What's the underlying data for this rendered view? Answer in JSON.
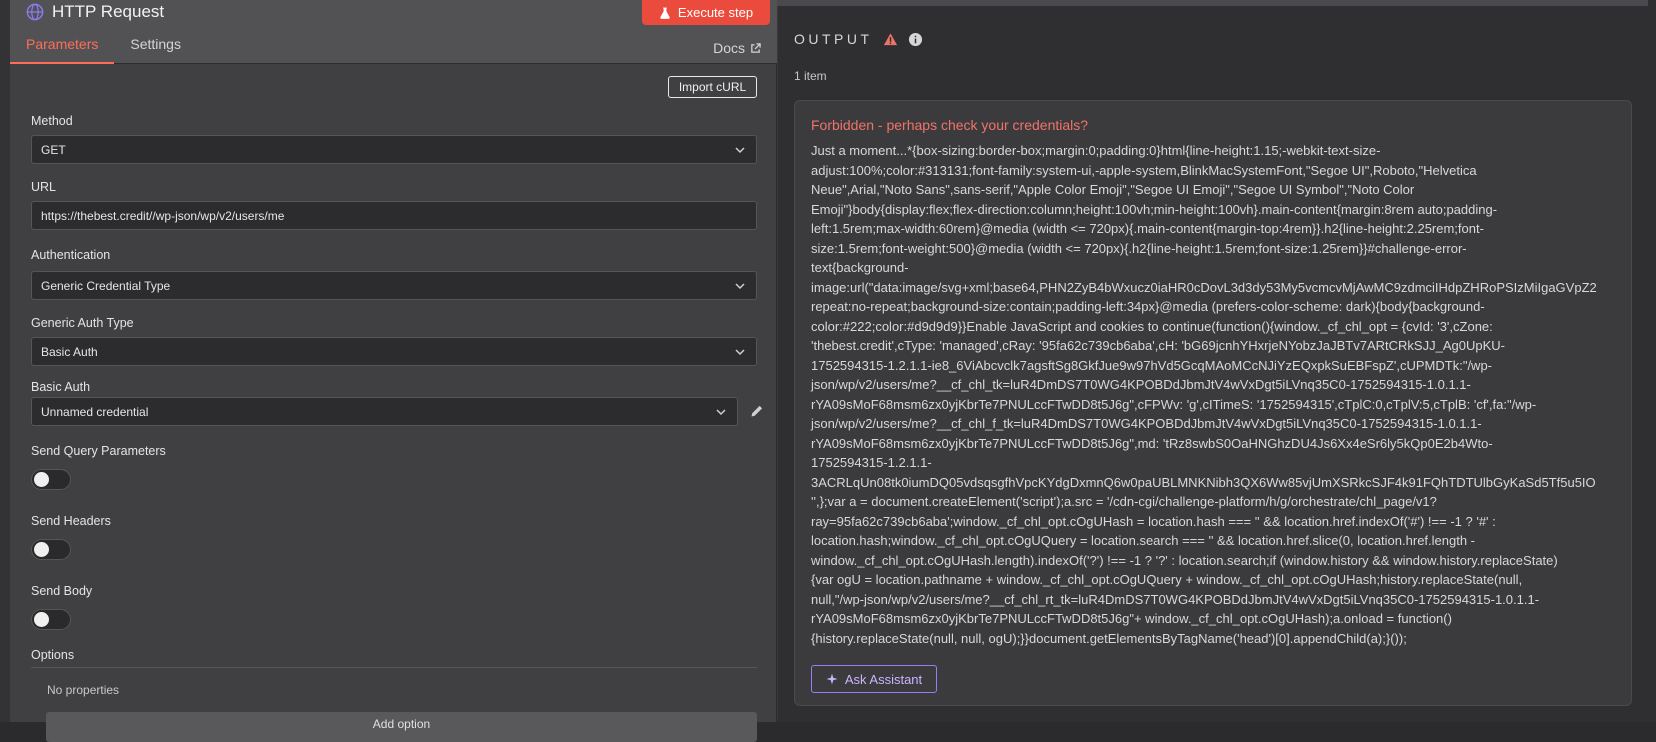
{
  "header": {
    "title": "HTTP Request",
    "execute_label": "Execute step",
    "tabs": [
      {
        "label": "Parameters"
      },
      {
        "label": "Settings"
      }
    ],
    "docs_label": "Docs"
  },
  "params": {
    "import_curl_label": "Import cURL",
    "method": {
      "label": "Method",
      "value": "GET"
    },
    "url": {
      "label": "URL",
      "value": "https://thebest.credit//wp-json/wp/v2/users/me"
    },
    "authentication": {
      "label": "Authentication",
      "value": "Generic Credential Type"
    },
    "generic_auth_type": {
      "label": "Generic Auth Type",
      "value": "Basic Auth"
    },
    "basic_auth": {
      "label": "Basic Auth",
      "value": "Unnamed credential"
    },
    "send_query": {
      "label": "Send Query Parameters"
    },
    "send_headers": {
      "label": "Send Headers"
    },
    "send_body": {
      "label": "Send Body"
    },
    "options": {
      "label": "Options",
      "empty_text": "No properties",
      "add_label": "Add option"
    }
  },
  "output": {
    "title": "OUTPUT",
    "items_count": "1 item",
    "error_title": "Forbidden - perhaps check your credentials?",
    "error_lines": [
      "Just a moment...*{box-sizing:border-box;margin:0;padding:0}html{line-height:1.15;-webkit-text-size-",
      "adjust:100%;color:#313131;font-family:system-ui,-apple-system,BlinkMacSystemFont,\"Segoe UI\",Roboto,\"Helvetica",
      "Neue\",Arial,\"Noto Sans\",sans-serif,\"Apple Color Emoji\",\"Segoe UI Emoji\",\"Segoe UI Symbol\",\"Noto Color",
      "Emoji\"}body{display:flex;flex-direction:column;height:100vh;min-height:100vh}.main-content{margin:8rem auto;padding-",
      "left:1.5rem;max-width:60rem}@media (width <= 720px){.main-content{margin-top:4rem}}.h2{line-height:2.25rem;font-",
      "size:1.5rem;font-weight:500}@media (width <= 720px){.h2{line-height:1.5rem;font-size:1.25rem}}#challenge-error-",
      "text{background-",
      "image:url(\"data:image/svg+xml;base64,PHN2ZyB4bWxucz0iaHR0cDovL3d3dy53My5vcmcvMjAwMC9zdmciIHdpZHRoPSIzMiIgaGVpZ2",
      "repeat:no-repeat;background-size:contain;padding-left:34px}@media (prefers-color-scheme: dark){body{background-",
      "color:#222;color:#d9d9d9}}Enable JavaScript and cookies to continue(function(){window._cf_chl_opt = {cvId: '3',cZone:",
      "'thebest.credit',cType: 'managed',cRay: '95fa62c739cb6aba',cH: 'bG69jcnhYHxrjeNYobzJaJBTv7ARtCRkSJJ_Ag0UpKU-",
      "1752594315-1.2.1.1-ie8_6ViAbcvclk7agsftSg8GkfJue9w97hVd5GcqMAoMCcNJiYzEQxpkSuEBFspZ',cUPMDTk:\"/wp-",
      "json/wp/v2/users/me?__cf_chl_tk=luR4DmDS7T0WG4KPOBDdJbmJtV4wVxDgt5iLVnq35C0-1752594315-1.0.1.1-",
      "rYA09sMoF68msm6zx0yjKbrTe7PNULccFTwDD8t5J6g\",cFPWv: 'g',cITimeS: '1752594315',cTplC:0,cTplV:5,cTplB: 'cf',fa:\"/wp-",
      "json/wp/v2/users/me?__cf_chl_f_tk=luR4DmDS7T0WG4KPOBDdJbmJtV4wVxDgt5iLVnq35C0-1752594315-1.0.1.1-",
      "rYA09sMoF68msm6zx0yjKbrTe7PNULccFTwDD8t5J6g\",md: 'tRz8swbS0OaHNGhzDU4Js6Xx4eSr6ly5kQp0E2b4Wto-",
      "1752594315-1.2.1.1-",
      "3ACRLqUn08tk0iumDQ05vdsqsgfhVpcKYdgDxmnQ6w0paUBLMNKNibh3QX6Ww85vjUmXSRkcSJF4k91FQhTDTUlbGyKaSd5Tf5u5IO",
      "'',};var a = document.createElement('script');a.src = '/cdn-cgi/challenge-platform/h/g/orchestrate/chl_page/v1?",
      "ray=95fa62c739cb6aba';window._cf_chl_opt.cOgUHash = location.hash === '' && location.href.indexOf('#') !== -1 ? '#' :",
      "location.hash;window._cf_chl_opt.cOgUQuery = location.search === '' && location.href.slice(0, location.href.length -",
      "window._cf_chl_opt.cOgUHash.length).indexOf('?') !== -1 ? '?' : location.search;if (window.history && window.history.replaceState)",
      "{var ogU = location.pathname + window._cf_chl_opt.cOgUQuery + window._cf_chl_opt.cOgUHash;history.replaceState(null,",
      "null,\"/wp-json/wp/v2/users/me?__cf_chl_rt_tk=luR4DmDS7T0WG4KPOBDdJbmJtV4wVxDgt5iLVnq35C0-1752594315-1.0.1.1-",
      "rYA09sMoF68msm6zx0yjKbrTe7PNULccFTwDD8t5J6g\"+ window._cf_chl_opt.cOgUHash);a.onload = function()",
      "{history.replaceState(null, null, ogU);}}document.getElementsByTagName('head')[0].appendChild(a);}());"
    ],
    "ask_assistant_label": "Ask Assistant"
  },
  "colors": {
    "accent": "#ff6d5a",
    "execute_bg": "#ea4b3c",
    "error_title": "#f0736a",
    "assistant": "#9c7cf0"
  },
  "icons": [
    "globe-icon",
    "flask-icon",
    "external-link-icon",
    "chevron-down-icon",
    "pencil-icon",
    "warning-icon",
    "info-icon",
    "sparkle-icon"
  ]
}
